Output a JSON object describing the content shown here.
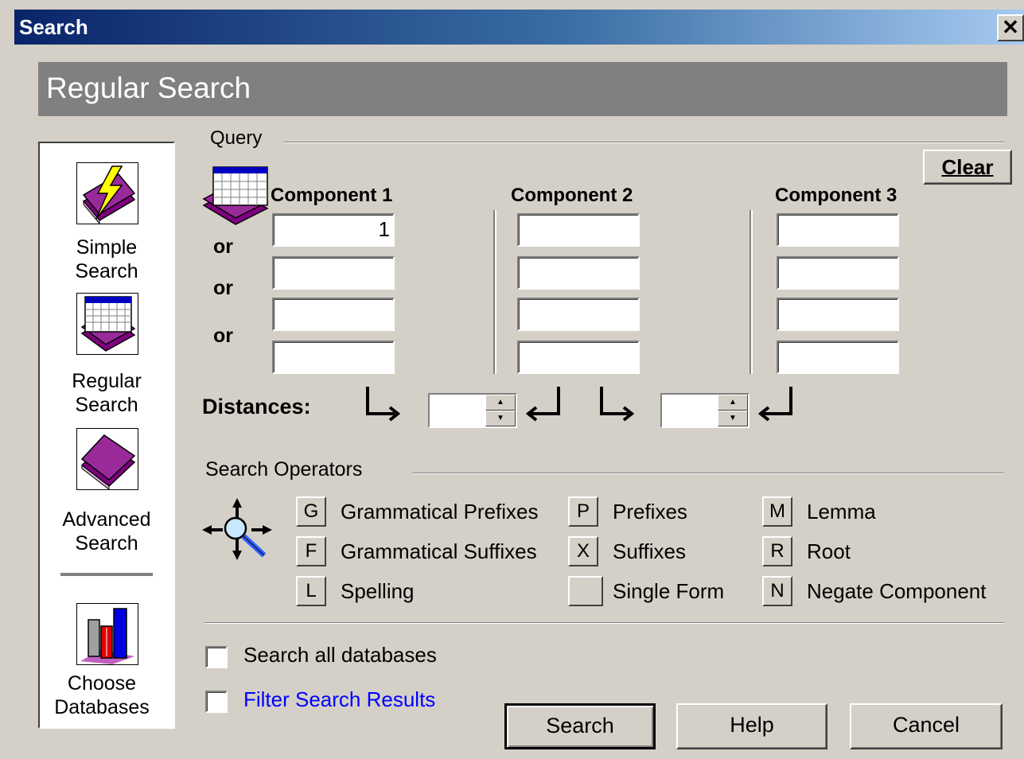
{
  "window": {
    "title": "Search",
    "close_glyph": "✕"
  },
  "banner": {
    "title": "Regular Search"
  },
  "nav": {
    "items": [
      {
        "label": "Simple\nSearch",
        "icon": "lightning-book-icon"
      },
      {
        "label": "Regular\nSearch",
        "icon": "grid-book-icon"
      },
      {
        "label": "Advanced\nSearch",
        "icon": "book-icon"
      },
      {
        "label": "Choose\nDatabases",
        "icon": "bookshelf-icon"
      }
    ]
  },
  "query": {
    "section_label": "Query",
    "clear_label": "Clear",
    "components": [
      {
        "heading": "Component 1",
        "values": [
          "1",
          "",
          "",
          ""
        ]
      },
      {
        "heading": "Component 2",
        "values": [
          "",
          "",
          "",
          ""
        ]
      },
      {
        "heading": "Component 3",
        "values": [
          "",
          "",
          "",
          ""
        ]
      }
    ],
    "or_labels": [
      "or",
      "or",
      "or"
    ],
    "distances_label": "Distances:",
    "distance_values": [
      "",
      ""
    ]
  },
  "operators": {
    "section_label": "Search Operators",
    "items": [
      {
        "key": "G",
        "label": "Grammatical Prefixes"
      },
      {
        "key": "F",
        "label": "Grammatical Suffixes"
      },
      {
        "key": "L",
        "label": "Spelling"
      },
      {
        "key": "P",
        "label": "Prefixes"
      },
      {
        "key": "X",
        "label": "Suffixes"
      },
      {
        "key": "",
        "label": "Single Form"
      },
      {
        "key": "M",
        "label": "Lemma"
      },
      {
        "key": "R",
        "label": "Root"
      },
      {
        "key": "N",
        "label": "Negate Component"
      }
    ]
  },
  "options": {
    "search_all_databases": {
      "label": "Search all databases",
      "checked": false
    },
    "filter_search_results": {
      "label": "Filter Search Results",
      "checked": false,
      "color": "#0000ff"
    }
  },
  "buttons": {
    "search": "Search",
    "help": "Help",
    "cancel": "Cancel"
  },
  "colors": {
    "title_bar": "#0a246a",
    "banner": "#808080",
    "dialog": "#d4d0c8",
    "link": "#0000ff"
  }
}
